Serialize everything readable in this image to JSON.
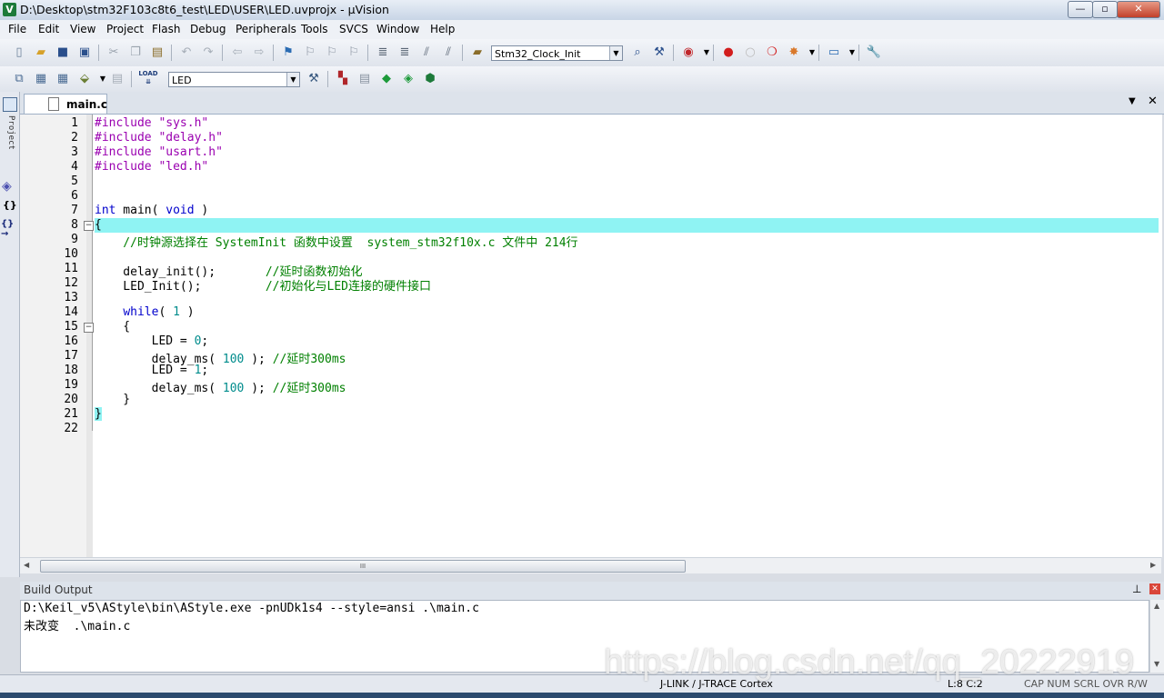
{
  "window": {
    "title": "D:\\Desktop\\stm32F103c8t6_test\\LED\\USER\\LED.uvprojx - µVision",
    "icon_letter": "V",
    "minimize": "—",
    "maximize": "▫",
    "close": "✕"
  },
  "menu": [
    "File",
    "Edit",
    "View",
    "Project",
    "Flash",
    "Debug",
    "Peripherals",
    "Tools",
    "SVCS",
    "Window",
    "Help"
  ],
  "toolbar1": {
    "function_combo": "Stm32_Clock_Init"
  },
  "toolbar2": {
    "target_combo": "LED",
    "load_label": "LOAD"
  },
  "left_dock": {
    "project_label": "Project",
    "braces": "{}",
    "braces_arrow": "{}→"
  },
  "editor": {
    "tab_label": "main.c",
    "line_numbers": [
      "1",
      "2",
      "3",
      "4",
      "5",
      "6",
      "7",
      "8",
      "9",
      "10",
      "11",
      "12",
      "13",
      "14",
      "15",
      "16",
      "17",
      "18",
      "19",
      "20",
      "21",
      "22"
    ],
    "lines": {
      "l1_pp": "#include ",
      "l1_str": "\"sys.h\"",
      "l2_pp": "#include ",
      "l2_str": "\"delay.h\"",
      "l3_pp": "#include ",
      "l3_str": "\"usart.h\"",
      "l4_pp": "#include ",
      "l4_str": "\"led.h\"",
      "l7_kw": "int",
      "l7_mid": " main( ",
      "l7_kw2": "void",
      "l7_end": " )",
      "l8": "{",
      "l9_cm": "    //时钟源选择在 SystemInit 函数中设置  system_stm32f10x.c 文件中 214行",
      "l11_code": "    delay_init();       ",
      "l11_cm": "//延时函数初始化",
      "l12_code": "    LED_Init();         ",
      "l12_cm": "//初始化与LED连接的硬件接口",
      "l14_ind": "    ",
      "l14_kw": "while",
      "l14_mid": "( ",
      "l14_num": "1",
      "l14_end": " )",
      "l15": "    {",
      "l16_code": "        LED = ",
      "l16_num": "0",
      "l16_end": ";",
      "l17_code": "        delay_ms( ",
      "l17_num": "100",
      "l17_mid": " ); ",
      "l17_cm": "//延时300ms",
      "l18_code": "        LED = ",
      "l18_num": "1",
      "l18_end": ";",
      "l19_code": "        delay_ms( ",
      "l19_num": "100",
      "l19_mid": " ); ",
      "l19_cm": "//延时300ms",
      "l20": "    }",
      "l21": "}"
    },
    "fold_marker": "−",
    "hscroll_grip": "III"
  },
  "build_output": {
    "title": "Build Output",
    "pin": "⊥",
    "close": "✕",
    "lines": [
      "D:\\Keil_v5\\AStyle\\bin\\AStyle.exe -pnUDk1s4 --style=ansi .\\main.c",
      "未改变  .\\main.c"
    ]
  },
  "status": {
    "debugger": "J-LINK / J-TRACE Cortex",
    "position": "L:8 C:2",
    "caps": "CAP  NUM  SCRL  OVR  R/W"
  },
  "watermark": "https://blog.csdn.net/qq_20222919",
  "colors": {
    "current_line": "#8ff3f3",
    "keyword": "#0000cc",
    "preprocessor": "#9a00b0",
    "comment": "#008000",
    "number": "#008c8c"
  }
}
